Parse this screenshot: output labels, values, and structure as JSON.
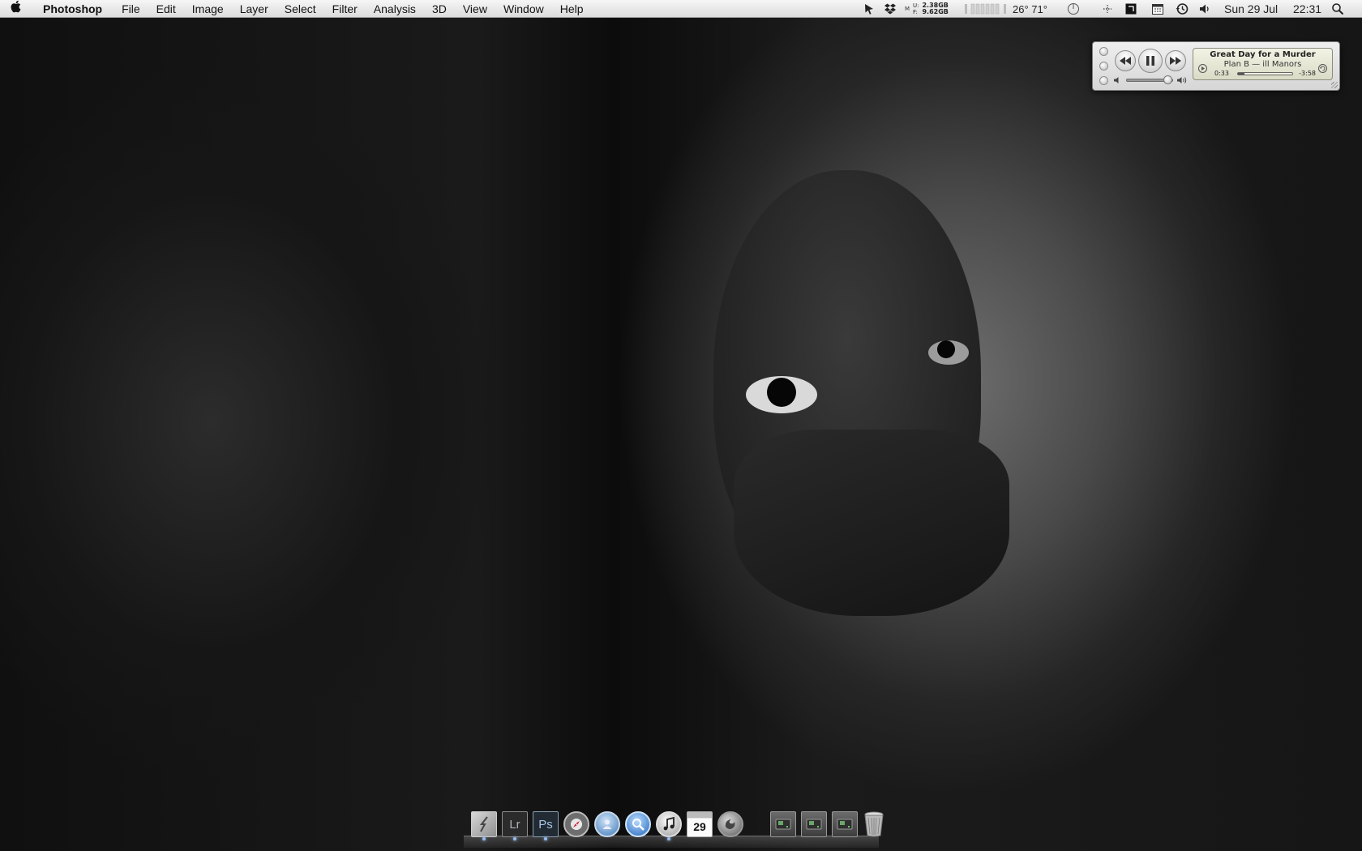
{
  "menubar": {
    "app_name": "Photoshop",
    "menus": [
      "File",
      "Edit",
      "Image",
      "Layer",
      "Select",
      "Filter",
      "Analysis",
      "3D",
      "View",
      "Window",
      "Help"
    ],
    "memory": {
      "u_label": "U:",
      "u_value": "2.38GB",
      "f_label": "F:",
      "f_value": "9.62GB",
      "m_label": "M"
    },
    "temperature": "26° 71°",
    "date": "Sun 29 Jul",
    "time": "22:31"
  },
  "miniplayer": {
    "track": "Great Day for a Murder",
    "artist_album": "Plan B — ill Manors",
    "elapsed": "0:33",
    "remaining": "-3:58",
    "progress_fraction": 0.12,
    "volume_fraction": 0.88
  },
  "dock": {
    "items": [
      {
        "name": "finder-icon",
        "label": ""
      },
      {
        "name": "lightroom-icon",
        "label": "Lr"
      },
      {
        "name": "photoshop-icon",
        "label": "Ps"
      },
      {
        "name": "safari-icon",
        "label": ""
      },
      {
        "name": "contacts-icon",
        "label": ""
      },
      {
        "name": "spotlight-app-icon",
        "label": ""
      },
      {
        "name": "itunes-icon",
        "label": ""
      },
      {
        "name": "calendar-icon",
        "label": "29"
      },
      {
        "name": "firefox-icon",
        "label": ""
      },
      {
        "name": "drive-1-icon",
        "label": ""
      },
      {
        "name": "drive-2-icon",
        "label": ""
      },
      {
        "name": "drive-3-icon",
        "label": ""
      },
      {
        "name": "trash-icon",
        "label": ""
      }
    ]
  }
}
